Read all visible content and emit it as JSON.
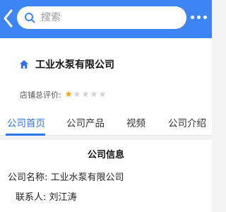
{
  "header": {
    "search_placeholder": "搜索",
    "back_icon": "chevron-left-icon",
    "more_icon": "more-dots-icon",
    "colors": {
      "bar": "#3d84f5",
      "accent": "#2d74ea",
      "star_on": "#f5a623",
      "star_off": "#d6d6d6"
    }
  },
  "shop": {
    "name": "工业水泵有限公司",
    "icon": "home-icon",
    "rating_label": "店铺总评价:",
    "rating_stars": 1,
    "rating_max": 5
  },
  "tabs": [
    {
      "label": "公司首页",
      "active": true
    },
    {
      "label": "公司产品",
      "active": false
    },
    {
      "label": "视频",
      "active": false
    },
    {
      "label": "公司介绍",
      "active": false
    }
  ],
  "company_info": {
    "title": "公司信息",
    "rows": [
      {
        "label": "公司名称:",
        "value": "工业水泵有限公司"
      },
      {
        "label": "联系人:",
        "value": "刘江涛"
      }
    ]
  }
}
